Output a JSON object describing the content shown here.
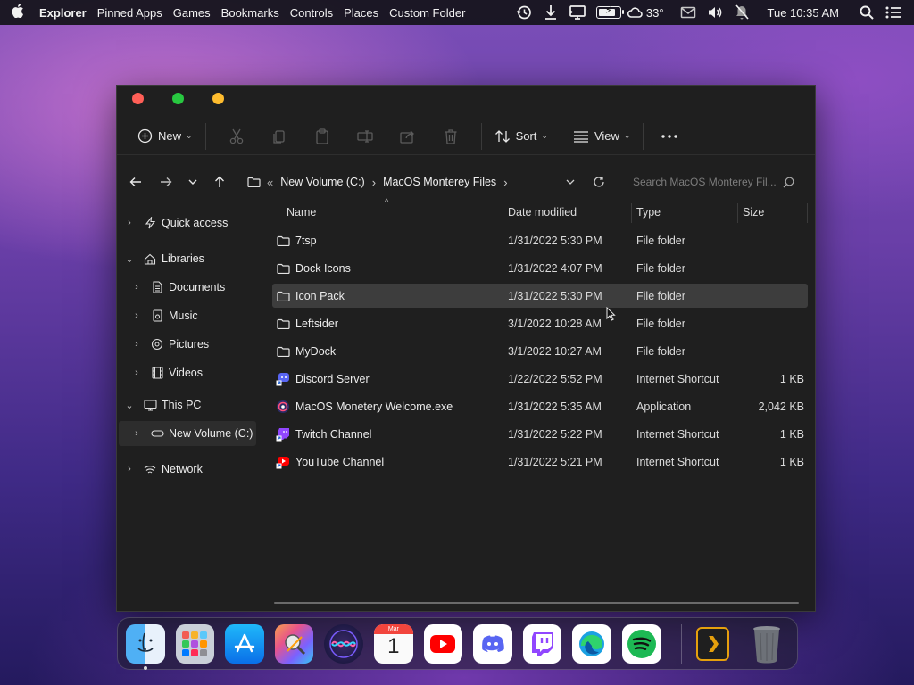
{
  "menubar": {
    "app_name": "Explorer",
    "menus": [
      "Pinned Apps",
      "Games",
      "Bookmarks",
      "Controls",
      "Places",
      "Custom Folder"
    ],
    "weather": "33°",
    "clock": "Tue 10:35 AM",
    "battery_level": 0.8,
    "icons": [
      "history-icon",
      "download-icon",
      "display-icon",
      "battery-icon",
      "cloud-icon",
      "mail-icon",
      "volume-icon",
      "notifications-off-icon",
      "search-icon",
      "control-center-icon"
    ]
  },
  "window": {
    "toolbar": {
      "new_label": "New",
      "sort_label": "Sort",
      "view_label": "View"
    },
    "breadcrumb": {
      "overflow": "«",
      "items": [
        "New Volume (C:)",
        "MacOS Monterey Files"
      ]
    },
    "search": {
      "placeholder": "Search MacOS Monterey Fil..."
    },
    "sidebar": {
      "items": [
        {
          "label": "Quick access",
          "icon": "star-icon"
        },
        {
          "label": "Libraries",
          "icon": "library-icon"
        },
        {
          "label": "Documents",
          "icon": "document-icon"
        },
        {
          "label": "Music",
          "icon": "music-icon"
        },
        {
          "label": "Pictures",
          "icon": "pictures-icon"
        },
        {
          "label": "Videos",
          "icon": "videos-icon"
        },
        {
          "label": "This PC",
          "icon": "monitor-icon"
        },
        {
          "label": "New Volume (C:)",
          "icon": "drive-icon"
        },
        {
          "label": "Network",
          "icon": "network-icon"
        }
      ]
    },
    "columns": [
      "Name",
      "Date modified",
      "Type",
      "Size"
    ],
    "files": [
      {
        "name": "7tsp",
        "date": "1/31/2022 5:30 PM",
        "type": "File folder",
        "size": "",
        "icon": "folder-icon"
      },
      {
        "name": "Dock Icons",
        "date": "1/31/2022 4:07 PM",
        "type": "File folder",
        "size": "",
        "icon": "folder-icon"
      },
      {
        "name": "Icon Pack",
        "date": "1/31/2022 5:30 PM",
        "type": "File folder",
        "size": "",
        "icon": "folder-icon"
      },
      {
        "name": "Leftsider",
        "date": "3/1/2022 10:28 AM",
        "type": "File folder",
        "size": "",
        "icon": "folder-icon"
      },
      {
        "name": "MyDock",
        "date": "3/1/2022 10:27 AM",
        "type": "File folder",
        "size": "",
        "icon": "folder-icon"
      },
      {
        "name": "Discord Server",
        "date": "1/22/2022 5:52 PM",
        "type": "Internet Shortcut",
        "size": "1 KB",
        "icon": "discord-shortcut-icon"
      },
      {
        "name": "MacOS Monetery Welcome.exe",
        "date": "1/31/2022 5:35 AM",
        "type": "Application",
        "size": "2,042 KB",
        "icon": "application-icon"
      },
      {
        "name": "Twitch Channel",
        "date": "1/31/2022 5:22 PM",
        "type": "Internet Shortcut",
        "size": "1 KB",
        "icon": "twitch-shortcut-icon"
      },
      {
        "name": "YouTube Channel",
        "date": "1/31/2022 5:21 PM",
        "type": "Internet Shortcut",
        "size": "1 KB",
        "icon": "youtube-shortcut-icon"
      }
    ],
    "selected_index": 2
  },
  "dock": {
    "calendar_month": "Mar",
    "calendar_day": "1",
    "apps": [
      "finder-icon",
      "launchpad-icon",
      "app-store-icon",
      "system-tools-icon",
      "siri-icon",
      "calendar-icon",
      "youtube-icon",
      "discord-icon",
      "twitch-icon",
      "edge-icon",
      "spotify-icon",
      "plex-icon",
      "trash-icon"
    ]
  },
  "colors": {
    "accent_purple": "#9146ff",
    "spotify_green": "#1db954",
    "youtube_red": "#ff0000",
    "discord_blurple": "#5865f2"
  }
}
